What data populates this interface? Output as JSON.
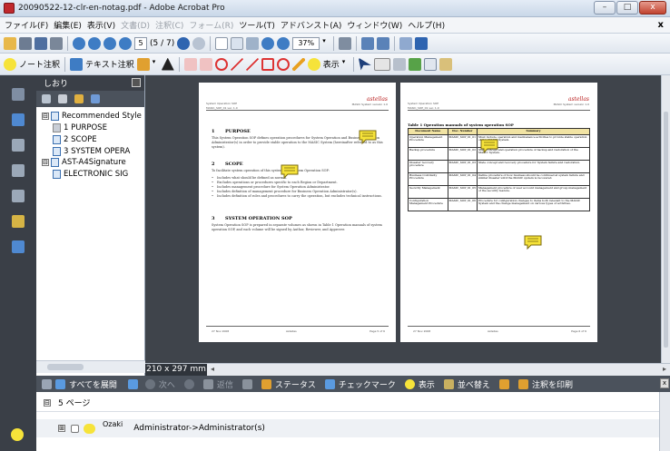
{
  "window": {
    "title": "20090522-12-clr-en-notag.pdf - Adobe Acrobat Pro",
    "btn_min": "–",
    "btn_max": "□",
    "btn_close": "x"
  },
  "menu": {
    "items": [
      {
        "label": "ファイル(F)",
        "enabled": true
      },
      {
        "label": "編集(E)",
        "enabled": true
      },
      {
        "label": "表示(V)",
        "enabled": true
      },
      {
        "label": "文書(D)",
        "enabled": false
      },
      {
        "label": "注釈(C)",
        "enabled": false
      },
      {
        "label": "フォーム(R)",
        "enabled": false
      },
      {
        "label": "ツール(T)",
        "enabled": true
      },
      {
        "label": "アドバンスト(A)",
        "enabled": true
      },
      {
        "label": "ウィンドウ(W)",
        "enabled": true
      },
      {
        "label": "ヘルプ(H)",
        "enabled": true
      }
    ],
    "close": "x"
  },
  "toolbar": {
    "page_current": "5",
    "page_count": "(5 / 7)",
    "zoom": "37%"
  },
  "toolbar2": {
    "sticky_note": "ノート注釈",
    "text_edit": "テキスト注釈",
    "show": "表示"
  },
  "bookmarks": {
    "title": "しおり",
    "items": [
      {
        "label": "Recommended Style",
        "level": 0,
        "toggle": "⊟"
      },
      {
        "label": "1 PURPOSE",
        "level": 1,
        "toggle": ""
      },
      {
        "label": "2 SCOPE",
        "level": 1,
        "toggle": ""
      },
      {
        "label": "3 SYSTEM OPERA",
        "level": 1,
        "toggle": ""
      },
      {
        "label": "AST-A4Signature",
        "level": 0,
        "toggle": "⊟"
      },
      {
        "label": "ELECTRONIC SIG",
        "level": 1,
        "toggle": ""
      }
    ]
  },
  "page_size": "210 x 297 mm",
  "page_left": {
    "header_left": "System Operation SOP",
    "header_left2": "MASIC_SOP_01 ver. 1.0",
    "logo": "astellas",
    "header_right": "MASIC System version 1.0",
    "s1_num": "1",
    "s1_title": "PURPOSE",
    "s1_text": "This System Operation SOP defines operation procedures for System Operation and Business Operation Administrator(s) in order to provide stable operation to the MASIC System (hereinafter referred to as this system).",
    "s2_num": "2",
    "s2_title": "SCOPE",
    "s2_text": "To facilitate system operation of this system, this System Operation SOP:",
    "s2_bullets": [
      "Includes what should be defined as normal.",
      "Excludes operations or procedures specific to each Region or Department.",
      "Includes management procedure for System Operation Administrator.",
      "Includes definition of management procedure for Business Operation Administrator(s).",
      "Includes definition of roles and procedures to carry the operation, but excludes technical instructions."
    ],
    "s3_num": "3",
    "s3_title": "SYSTEM OPERATION SOP",
    "s3_text": "System Operation SOP is prepared in separate volumes as shown in Table 1 Operation manuals of system operation SOP, and each volume will be signed by Author, Reviewer, and Approver.",
    "foot_left": "27 Nov 2008",
    "foot_mid": "Astellas",
    "foot_right": "Page 5 of 6"
  },
  "page_right": {
    "header_left": "System Operation SOP",
    "header_left2": "MASIC_SOP_01 ver. 1.0",
    "logo": "astellas",
    "header_right": "MASIC System version 1.0",
    "table_caption": "Table 1 Operation manuals of system operation SOP",
    "table_headers": [
      "Document Name",
      "Doc. Number",
      "Summary"
    ],
    "table_rows": [
      [
        "Operation Management Procedure",
        "MASIC_SOP_01_01",
        "Must include operation and maintenance activities to provide stable operation of this MASIC System."
      ],
      [
        "Backup procedure",
        "MASIC_SOP_01_02",
        "State concept and operation procedure of backup and restoration of the MASIC System."
      ],
      [
        "Disaster recovery procedure",
        "MASIC_SOP_01_03",
        "State concept and recovery procedure for System failure and restoration."
      ],
      [
        "Business Continuity Procedure",
        "MASIC_SOP_01_04",
        "Define procedure of how business should be continued at system failure and similar disaster until the MASIC system is recovered."
      ],
      [
        "Security Management",
        "MASIC_SOP_01_05",
        "Management procedure of user account management and group management of the security feature."
      ],
      [
        "Configuration Management Procedure",
        "MASIC_SOP_01_06",
        "Procedure for configuration changes to items both relevant to the MASIC System and the change management on various types of activities."
      ]
    ],
    "foot_left": "27 Nov 2008",
    "foot_mid": "Astellas",
    "foot_right": "Page 6 of 6"
  },
  "comments": {
    "toolbar": {
      "expand_all": "すべてを展開",
      "next": "次へ",
      "reply": "返信",
      "status": "ステータス",
      "checkmark": "チェックマーク",
      "show": "表示",
      "sort": "並べ替え",
      "print": "注釈を印刷"
    },
    "page_label": "5 ページ",
    "page_toggle": "⊟",
    "entry": {
      "toggle": "⊞",
      "author": "Ozaki",
      "text": "Administrator->Administrator(s)"
    }
  },
  "colors": {
    "dark_panel": "#3a3f47",
    "note_yellow": "#f6e33a",
    "accent_red": "#c0282d"
  }
}
